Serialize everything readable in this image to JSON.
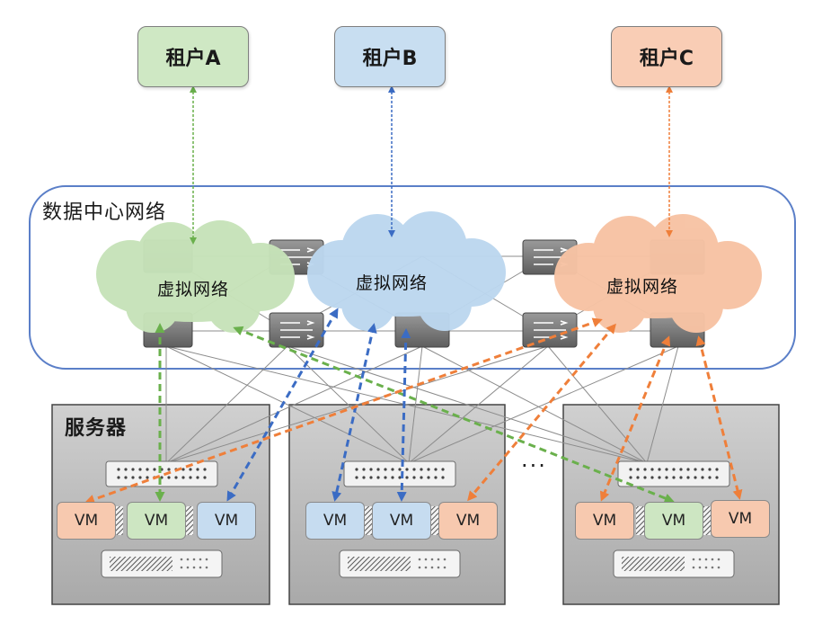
{
  "tenants": {
    "a": "租户A",
    "b": "租户B",
    "c": "租户C"
  },
  "datacenter_label": "数据中心网络",
  "virtual_network_label": "虚拟网络",
  "servers_label": "服务器",
  "more_indicator": "...",
  "vm_label": "VM",
  "colors": {
    "tenant_a": "#cfe8c4",
    "tenant_b": "#c8def1",
    "tenant_c": "#f9cdb5",
    "link_a": "#6ab04c",
    "link_b": "#3b6cc4",
    "link_c": "#ef7f3a",
    "datacenter_border": "#5b7fc8",
    "server_bg": "#bdbdbd"
  }
}
